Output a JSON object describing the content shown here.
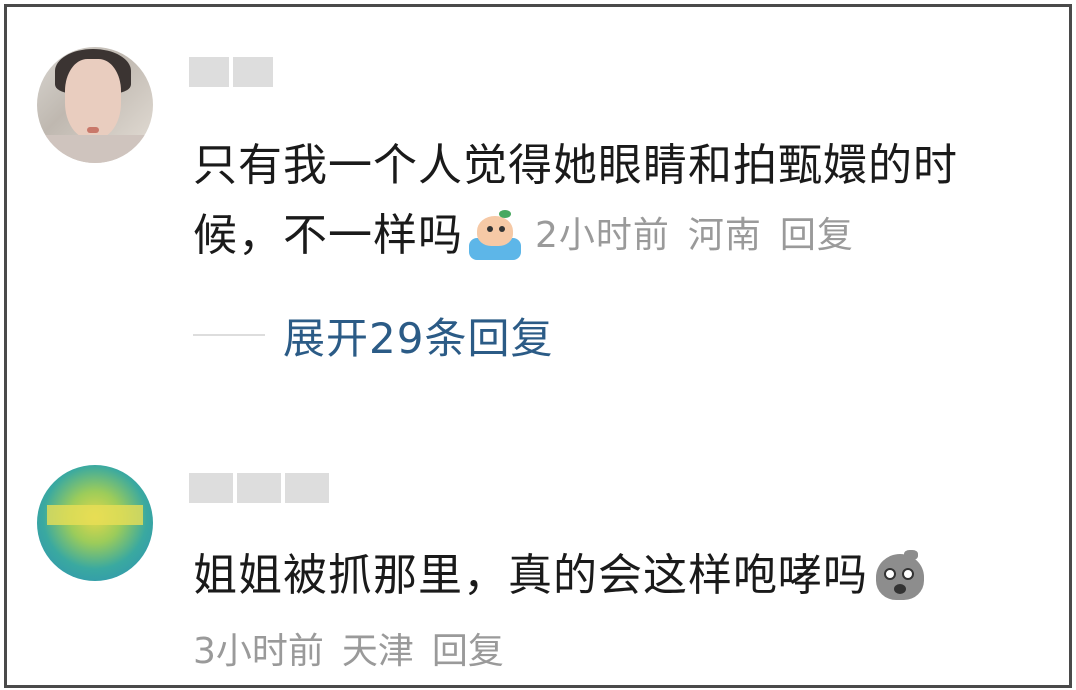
{
  "comments": [
    {
      "text_line1": "只有我一个人觉得她眼睛和拍甄嬛的时",
      "text_line2": "候，不一样吗",
      "emoji": "crying-emoji",
      "time": "2小时前",
      "location": "河南",
      "reply": "回复",
      "expand": {
        "label": "展开29条回复"
      }
    },
    {
      "text_line1": "姐姐被抓那里，真的会这样咆哮吗",
      "emoji": "shocked-emoji",
      "time": "3小时前",
      "location": "天津",
      "reply": "回复"
    }
  ],
  "colors": {
    "text": "#1a1a1a",
    "meta": "#9a9a9a",
    "link": "#2b5b86",
    "border": "#4a4a4a"
  }
}
